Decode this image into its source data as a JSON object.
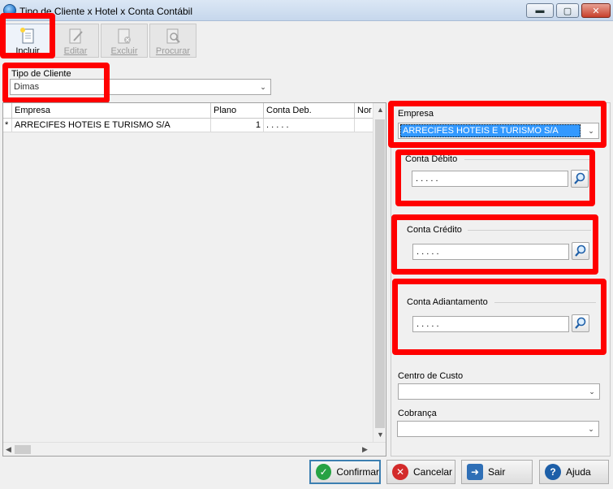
{
  "window": {
    "title": "Tipo de Cliente x Hotel x Conta Contábil"
  },
  "toolbar": {
    "incluir": "Incluir",
    "editar": "Editar",
    "excluir": "Excluir",
    "procurar": "Procurar"
  },
  "tipo_cliente": {
    "label": "Tipo de Cliente",
    "value": "Dimas"
  },
  "grid": {
    "headers": [
      "Empresa",
      "Plano",
      "Conta Deb.",
      "Nor"
    ],
    "rows": [
      {
        "marker": "*",
        "empresa": "ARRECIFES HOTEIS E TURISMO S/A",
        "plano": "1",
        "conta_deb": ". . . . ."
      }
    ]
  },
  "panel": {
    "empresa_label": "Empresa",
    "empresa_value": "ARRECIFES HOTEIS E TURISMO S/A",
    "conta_debito_label": "Conta Débito",
    "conta_debito_value": ". . . . .",
    "conta_credito_label": "Conta Crédito",
    "conta_credito_value": ". . . . .",
    "conta_adiantamento_label": "Conta Adiantamento",
    "conta_adiantamento_value": ". . . . .",
    "centro_custo_label": "Centro de Custo",
    "centro_custo_value": "",
    "cobranca_label": "Cobrança",
    "cobranca_value": ""
  },
  "buttons": {
    "confirmar": "Confirmar",
    "cancelar": "Cancelar",
    "sair": "Sair",
    "ajuda": "Ajuda"
  },
  "colors": {
    "highlight": "#ff0000",
    "selection": "#3399ff"
  }
}
